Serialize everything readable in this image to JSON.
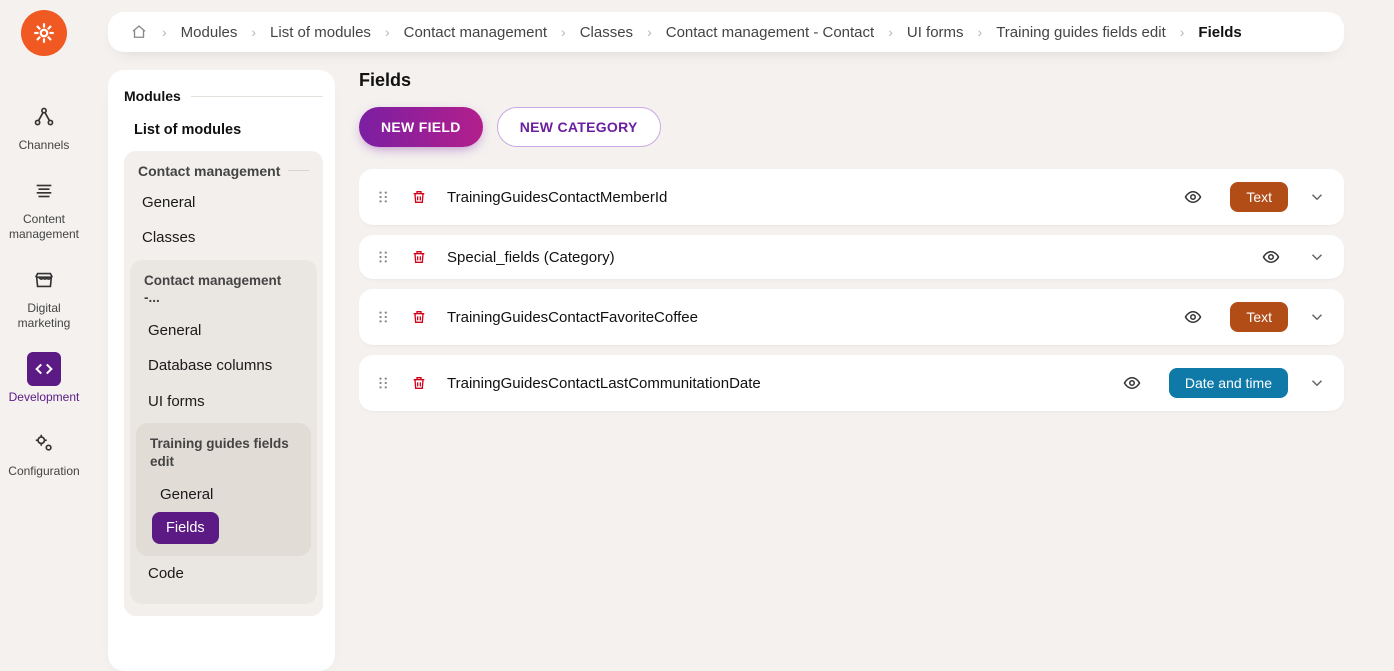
{
  "rail": {
    "items": [
      {
        "label": "Channels",
        "icon": "network"
      },
      {
        "label": "Content management",
        "icon": "lines"
      },
      {
        "label": "Digital marketing",
        "icon": "store"
      },
      {
        "label": "Development",
        "icon": "code"
      },
      {
        "label": "Configuration",
        "icon": "cogs"
      }
    ],
    "active_index": 3
  },
  "breadcrumbs": [
    "Modules",
    "List of modules",
    "Contact management",
    "Classes",
    "Contact management - Contact",
    "UI forms",
    "Training guides fields edit",
    "Fields"
  ],
  "sidebar": {
    "title": "Modules",
    "list_label": "List of modules",
    "module": {
      "name": "Contact management",
      "items": [
        "General",
        "Classes"
      ]
    },
    "cls": {
      "name": "Contact management -...",
      "items": [
        "General",
        "Database columns",
        "UI forms"
      ]
    },
    "form": {
      "name": "Training guides fields edit",
      "items": [
        "General",
        "Fields"
      ],
      "active_index": 1
    },
    "tail_item": "Code"
  },
  "content": {
    "title": "Fields",
    "buttons": {
      "new_field": "NEW FIELD",
      "new_category": "NEW CATEGORY"
    },
    "cards": [
      {
        "name": "TrainingGuidesContactMemberId",
        "type": "Text",
        "badge": "text"
      },
      {
        "name": "Special_fields (Category)",
        "type": null,
        "badge": null
      },
      {
        "name": "TrainingGuidesContactFavoriteCoffee",
        "type": "Text",
        "badge": "text"
      },
      {
        "name": "TrainingGuidesContactLastCommunitationDate",
        "type": "Date and time",
        "badge": "datetime"
      }
    ]
  },
  "colors": {
    "brand_orange": "#F05A22",
    "brand_purple": "#6B1F9E",
    "blue_badge": "#0F7AA8",
    "brown_badge": "#B24D17"
  }
}
